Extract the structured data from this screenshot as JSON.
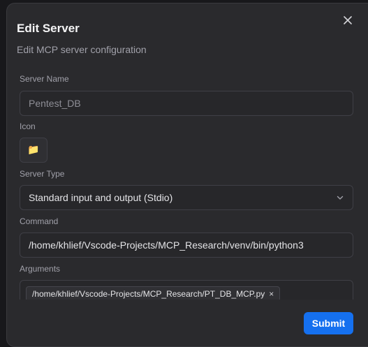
{
  "dialog": {
    "title": "Edit Server",
    "subtitle": "Edit MCP server configuration",
    "close_icon": "close-icon"
  },
  "form": {
    "server_name": {
      "label": "Server Name",
      "value": "Pentest_DB"
    },
    "icon": {
      "label": "Icon",
      "glyph": "📁",
      "icon_name": "folder-icon"
    },
    "server_type": {
      "label": "Server Type",
      "value": "Standard input and output (Stdio)",
      "chevron_icon": "chevron-down-icon"
    },
    "command": {
      "label": "Command",
      "value": "/home/khlief/Vscode-Projects/MCP_Research/venv/bin/python3"
    },
    "arguments": {
      "label": "Arguments",
      "chips": [
        {
          "value": "/home/khlief/Vscode-Projects/MCP_Research/PT_DB_MCP.py",
          "remove": "×"
        }
      ]
    }
  },
  "footer": {
    "submit_label": "Submit"
  },
  "colors": {
    "accent": "#1570ef",
    "dialog_bg": "#2a2a2d",
    "field_bg": "#27272a"
  }
}
